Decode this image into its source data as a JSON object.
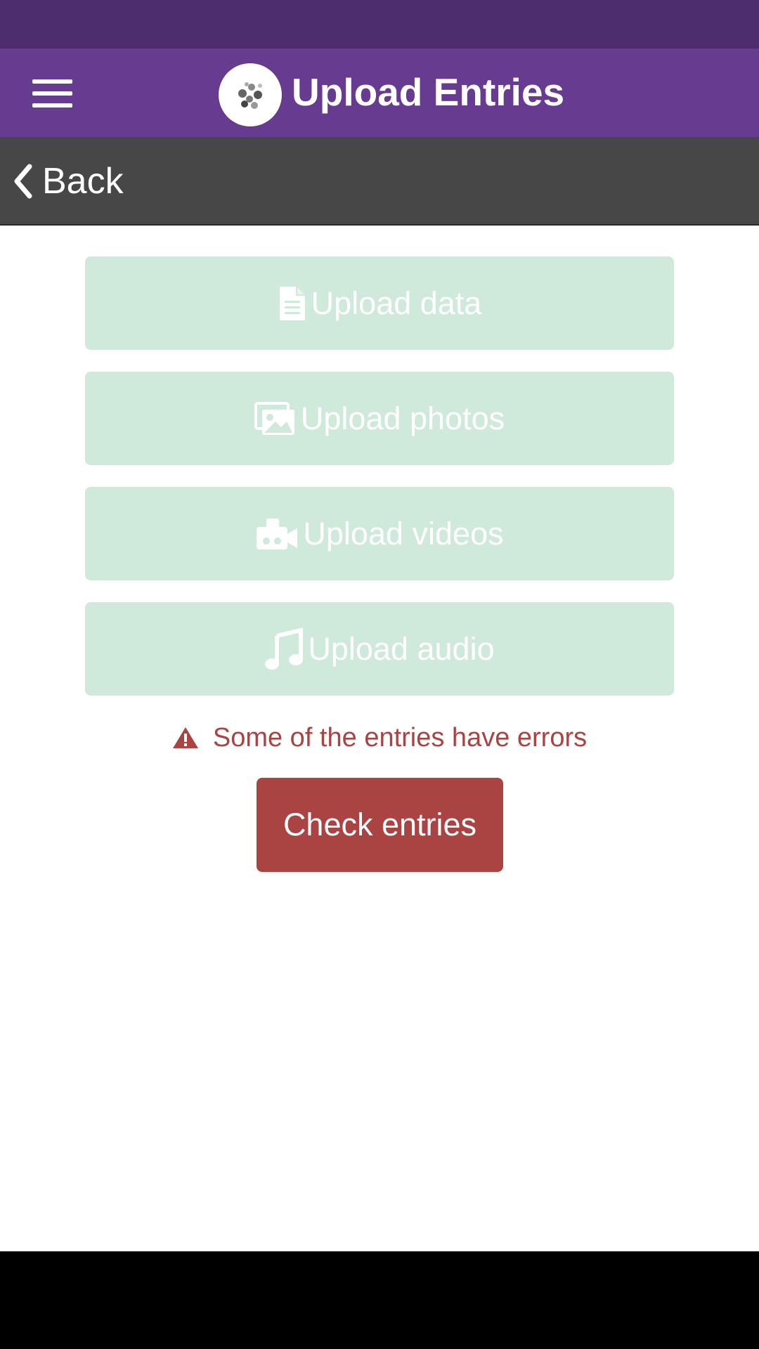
{
  "header": {
    "title": "Upload Entries",
    "menu_icon": "hamburger-menu-icon",
    "logo_icon": "app-logo-icon"
  },
  "nav": {
    "back_label": "Back",
    "back_icon": "chevron-left-icon"
  },
  "uploads": [
    {
      "label": "Upload data",
      "icon": "file-icon"
    },
    {
      "label": "Upload photos",
      "icon": "photos-icon"
    },
    {
      "label": "Upload videos",
      "icon": "video-camera-icon"
    },
    {
      "label": "Upload audio",
      "icon": "music-note-icon"
    }
  ],
  "error": {
    "message": "Some of the entries have errors",
    "icon": "warning-icon"
  },
  "actions": {
    "check_label": "Check entries"
  },
  "colors": {
    "status_bar": "#4d2d6d",
    "header": "#673b90",
    "nav_bar": "#474747",
    "upload_button": "#cfe9db",
    "error": "#a94442",
    "system_nav": "#000000"
  }
}
